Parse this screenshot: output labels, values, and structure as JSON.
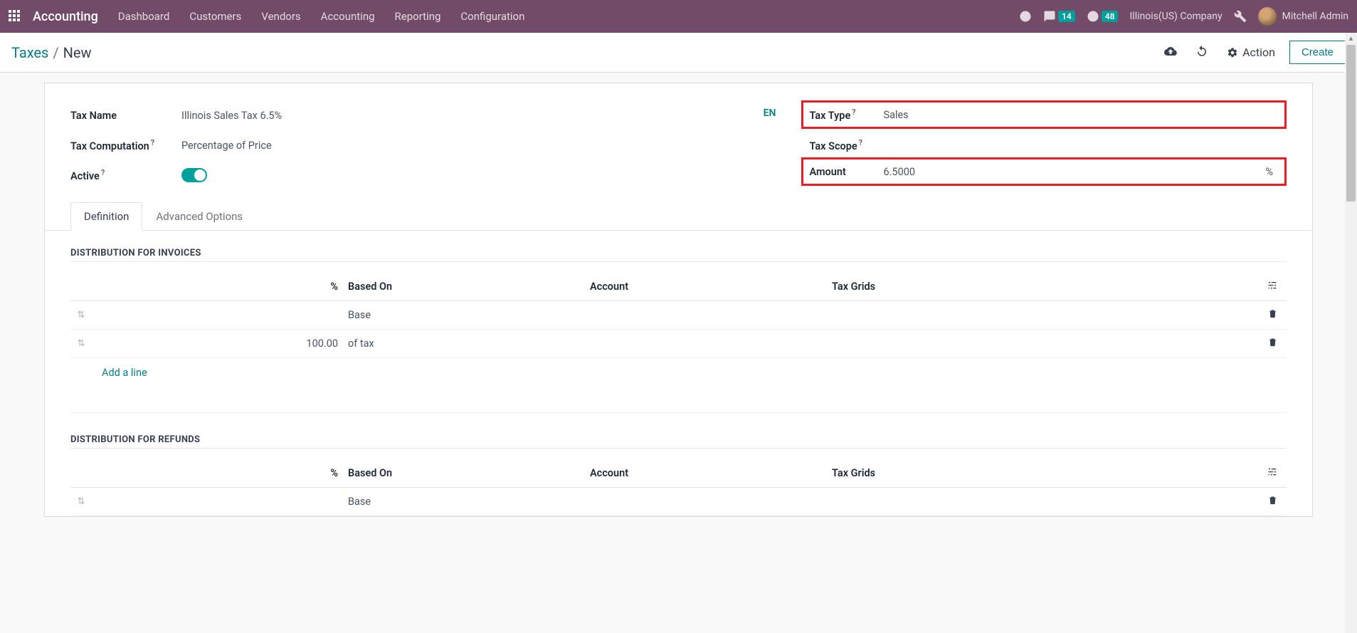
{
  "navbar": {
    "brand": "Accounting",
    "items": [
      "Dashboard",
      "Customers",
      "Vendors",
      "Accounting",
      "Reporting",
      "Configuration"
    ],
    "messages_count": "14",
    "activities_count": "48",
    "company": "Illinois(US) Company",
    "user": "Mitchell Admin"
  },
  "controlbar": {
    "crumb_root": "Taxes",
    "crumb_current": "New",
    "action_label": "Action",
    "create_label": "Create"
  },
  "form": {
    "tax_name_label": "Tax Name",
    "tax_name_value": "Illinois Sales Tax 6.5%",
    "lang": "EN",
    "tax_computation_label": "Tax Computation",
    "tax_computation_value": "Percentage of Price",
    "active_label": "Active",
    "tax_type_label": "Tax Type",
    "tax_type_value": "Sales",
    "tax_scope_label": "Tax Scope",
    "amount_label": "Amount",
    "amount_value": "6.5000",
    "amount_unit": "%"
  },
  "tabs": {
    "definition": "Definition",
    "advanced": "Advanced Options"
  },
  "dist_invoices": {
    "title": "DISTRIBUTION FOR INVOICES",
    "headers": {
      "pct": "%",
      "based": "Based On",
      "account": "Account",
      "grids": "Tax Grids"
    },
    "rows": [
      {
        "pct": "",
        "based": "Base"
      },
      {
        "pct": "100.00",
        "based": "of tax"
      }
    ],
    "add_line": "Add a line"
  },
  "dist_refunds": {
    "title": "DISTRIBUTION FOR REFUNDS",
    "headers": {
      "pct": "%",
      "based": "Based On",
      "account": "Account",
      "grids": "Tax Grids"
    },
    "rows": [
      {
        "pct": "",
        "based": "Base"
      }
    ]
  }
}
